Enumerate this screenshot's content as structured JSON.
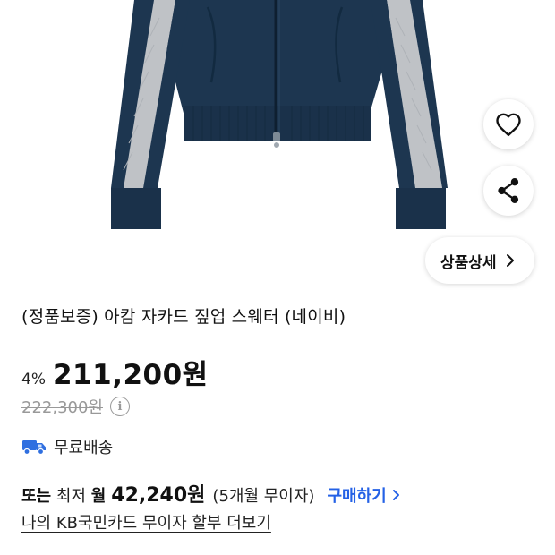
{
  "product": {
    "title": "(정품보증) 아캄 자카드 짚업 스웨터 (네이비)",
    "detail_button_label": "상품상세"
  },
  "price": {
    "discount": "4%",
    "sale_price": "211,200원",
    "original_price": "222,300원"
  },
  "shipping": {
    "label": "무료배송"
  },
  "installment": {
    "prefix": "또는",
    "min_label": "최저",
    "month_label": "월",
    "amount": "42,240원",
    "terms": "(5개월 무이자)",
    "buy_link": "구매하기"
  },
  "card_link": "나의 KB국민카드 무이자 할부 더보기",
  "colors": {
    "accent_link": "#2461e6",
    "sweater_navy": "#1d3650",
    "sleeve_stripe": "#bfc2c6",
    "strikethrough_gray": "#999999",
    "truck_blue": "#2f6fe0"
  },
  "icons": [
    "heart-icon",
    "share-icon",
    "chevron-right-icon",
    "info-icon",
    "truck-icon"
  ]
}
